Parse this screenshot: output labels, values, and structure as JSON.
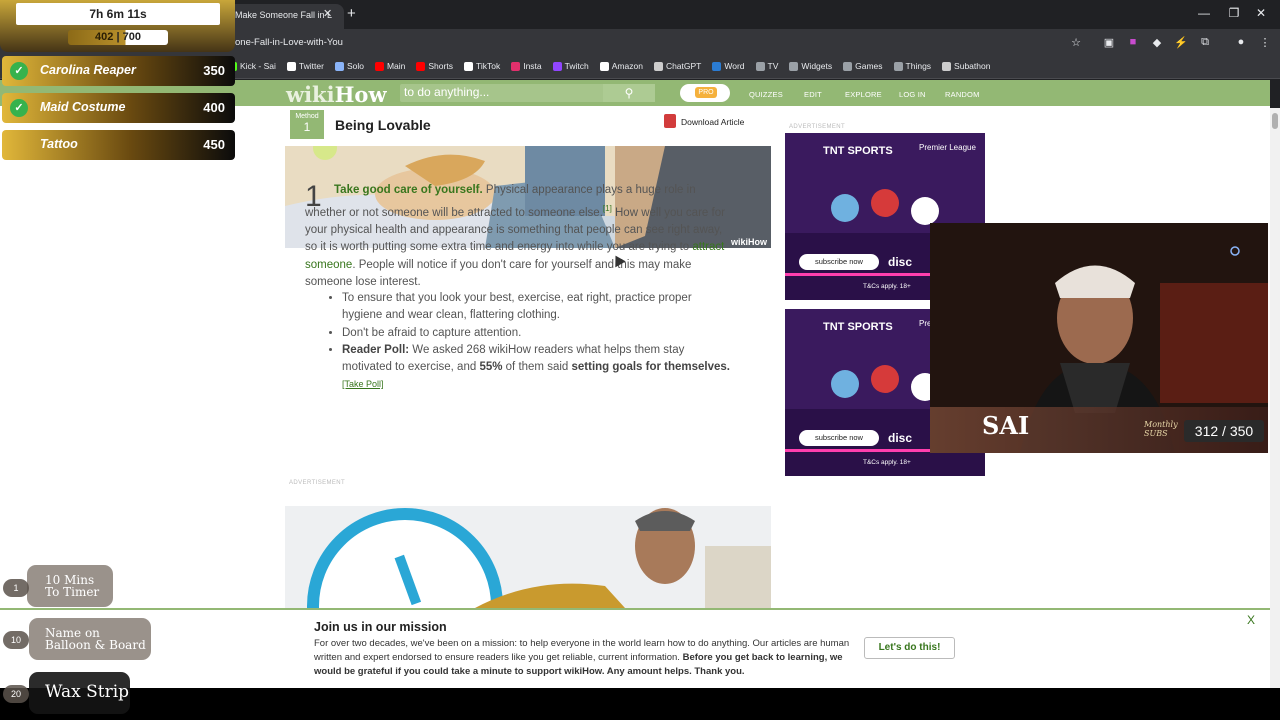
{
  "browser": {
    "tab_title": "Make Someone Fall in L",
    "url": "one-Fall-in-Love-with-You",
    "bookmarks": [
      {
        "label": "Kick - Sai",
        "icon": "kick-icon",
        "color": "#53fc18"
      },
      {
        "label": "Twitter",
        "icon": "x-icon",
        "color": "#ffffff"
      },
      {
        "label": "Solo",
        "icon": "solo-icon",
        "color": "#8ab4f8"
      },
      {
        "label": "Main",
        "icon": "youtube-icon",
        "color": "#ff0000"
      },
      {
        "label": "Shorts",
        "icon": "youtube-icon",
        "color": "#ff0000"
      },
      {
        "label": "TikTok",
        "icon": "tiktok-icon",
        "color": "#ffffff"
      },
      {
        "label": "Insta",
        "icon": "instagram-icon",
        "color": "#e1306c"
      },
      {
        "label": "Twitch",
        "icon": "twitch-icon",
        "color": "#9146ff"
      },
      {
        "label": "Amazon",
        "icon": "amazon-icon",
        "color": "#ffffff"
      },
      {
        "label": "ChatGPT",
        "icon": "chatgpt-icon",
        "color": "#cccccc"
      },
      {
        "label": "Word",
        "icon": "word-icon",
        "color": "#2b7cd3"
      },
      {
        "label": "TV",
        "icon": "folder-icon",
        "color": "#9aa0a6"
      },
      {
        "label": "Widgets",
        "icon": "folder-icon",
        "color": "#9aa0a6"
      },
      {
        "label": "Games",
        "icon": "folder-icon",
        "color": "#9aa0a6"
      },
      {
        "label": "Things",
        "icon": "folder-icon",
        "color": "#9aa0a6"
      },
      {
        "label": "Subathon",
        "icon": "subathon-icon",
        "color": "#cccccc"
      }
    ]
  },
  "wikihow": {
    "logo_wiki": "wiki",
    "logo_how": "How",
    "search_placeholder": "to do anything...",
    "pro_label": "PRO",
    "nav": [
      "QUIZZES",
      "EDIT",
      "EXPLORE",
      "LOG IN",
      "RANDOM"
    ],
    "method_label": "Method",
    "method_number": "1",
    "method_title": "Being Lovable",
    "download_label": "Download Article",
    "image_watermark": "wikiHow",
    "step_number": "1",
    "step_bold": "Take good care",
    "step_bold2": " of yourself.",
    "step_text1": " Physical appearance plays a huge role in whether or not someone will be attracted to someone else.",
    "step_ref": "[1]",
    "step_text2": " How well you care for your physical health and appearance is something that people can see right away, so it is worth putting some extra time and energy into while you are trying to ",
    "step_link": "attract someone",
    "step_text3": ". People will notice if you don't care for yourself and this may make someone lose interest.",
    "bullet1": "To ensure that you look your best, exercise, eat right, practice proper hygiene and wear clean, flattering clothing.",
    "bullet2": "Don't be afraid to capture attention.",
    "poll_label": "Reader Poll:",
    "poll_text1": " We asked 268 wikiHow readers what helps them stay motivated to exercise, and ",
    "poll_pct": "55%",
    "poll_text2": " of them said ",
    "poll_answer": "setting goals for themselves.",
    "poll_link": "[Take Poll]",
    "advertisement_label": "ADVERTISEMENT"
  },
  "ads": {
    "brand": "TNT SPORTS",
    "league": "Premier League",
    "cta": "subscribe now",
    "disc": "disc",
    "terms": "T&Cs apply. 18+"
  },
  "banner": {
    "title": "Join us in our mission",
    "body_regular": "For over two decades, we've been on a mission: to help everyone in the world learn how to do anything. Our articles are human written and expert endorsed to ensure readers like you get reliable, current information. ",
    "body_bold": "Before you get back to learning, we would be grateful if you could take a minute to support wikiHow. Any amount helps. Thank you.",
    "button": "Let's do this!",
    "close": "X"
  },
  "stream": {
    "timer": "7h 6m 11s",
    "sub_goal_current": "402",
    "sub_goal_sep": " | ",
    "sub_goal_target": "700",
    "sub_goal_progress": 0.574,
    "goals": [
      {
        "label": "Carolina Reaper",
        "value": "350",
        "done": true
      },
      {
        "label": "Maid Costume",
        "value": "400",
        "done": true
      },
      {
        "label": "Tattoo",
        "value": "450",
        "done": false
      }
    ],
    "rewards": [
      {
        "count": "1",
        "label": "10 Mins To Timer"
      },
      {
        "count": "10",
        "label": "Name on Balloon & Board"
      },
      {
        "count": "20",
        "label": "Wax Strip"
      }
    ],
    "cam_name": "SAI",
    "subs_label_1": "Monthly",
    "subs_label_2": "SUBS",
    "subs_value": "312 / 350"
  }
}
